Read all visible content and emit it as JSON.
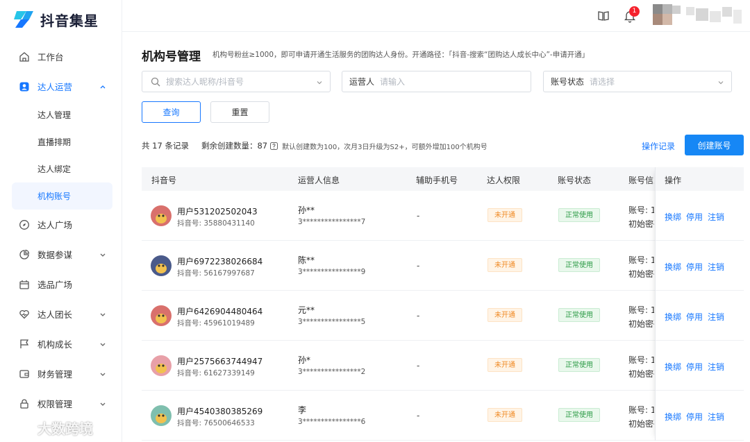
{
  "app": {
    "name": "抖音集星"
  },
  "sidebar": {
    "items": [
      {
        "label": "工作台",
        "icon": "home-icon"
      },
      {
        "label": "达人运营",
        "icon": "user-icon",
        "expanded": true
      },
      {
        "label": "达人广场",
        "icon": "compass-icon"
      },
      {
        "label": "数据参谋",
        "icon": "pie-chart-icon"
      },
      {
        "label": "选品广场",
        "icon": "shop-icon"
      },
      {
        "label": "达人团长",
        "icon": "heart-icon"
      },
      {
        "label": "机构成长",
        "icon": "flag-icon"
      },
      {
        "label": "财务管理",
        "icon": "wallet-icon"
      },
      {
        "label": "权限管理",
        "icon": "lock-icon"
      }
    ],
    "sub_items": [
      {
        "label": "达人管理"
      },
      {
        "label": "直播排期"
      },
      {
        "label": "达人绑定"
      },
      {
        "label": "机构账号",
        "selected": true
      }
    ]
  },
  "topbar": {
    "notification_count": "1"
  },
  "page": {
    "title": "机构号管理",
    "desc": "机构号粉丝≥1000，即可申请开通生活服务的团购达人身份。开通路径：「抖音-搜索“团购达人成长中心”-申请开通」"
  },
  "filters": {
    "search_placeholder": "搜索达人昵称/抖音号",
    "operator_label": "运营人",
    "operator_placeholder": "请输入",
    "status_label": "账号状态",
    "status_placeholder": "请选择"
  },
  "buttons": {
    "query": "查询",
    "reset": "重置",
    "op_log": "操作记录",
    "create": "创建账号"
  },
  "summary": {
    "total": "共 17 条记录",
    "remain": "剩余创建数量：87",
    "note": "默认创建数为100，次月3日升级为S2+，可额外增加100个机构号"
  },
  "table": {
    "headers": [
      "抖音号",
      "运营人信息",
      "辅助手机号",
      "达人权限",
      "账号状态",
      "账号信息",
      "操作"
    ],
    "rows": [
      {
        "name": "用户531202502043",
        "douyin_id": "抖音号: 35880431140",
        "op_name": "孙**",
        "op_phone": "3****************7",
        "phone": "-",
        "permission": "未开通",
        "status": "正常使用",
        "acct": "账号: 1",
        "pwd": "初始密码",
        "avatar_color": "#d9706c"
      },
      {
        "name": "用户6972238026684",
        "douyin_id": "抖音号: 56167997687",
        "op_name": "陈**",
        "op_phone": "3****************9",
        "phone": "-",
        "permission": "未开通",
        "status": "正常使用",
        "acct": "账号: 1",
        "pwd": "初始密码",
        "avatar_color": "#4a5a8a"
      },
      {
        "name": "用户6426904480464",
        "douyin_id": "抖音号: 45961019489",
        "op_name": "元**",
        "op_phone": "3****************5",
        "phone": "-",
        "permission": "未开通",
        "status": "正常使用",
        "acct": "账号: 1",
        "pwd": "初始密码",
        "avatar_color": "#d9706c"
      },
      {
        "name": "用户2575663744947",
        "douyin_id": "抖音号: 61627339149",
        "op_name": "孙*",
        "op_phone": "3****************2",
        "phone": "-",
        "permission": "未开通",
        "status": "正常使用",
        "acct": "账号: 1",
        "pwd": "初始密码",
        "avatar_color": "#e8a0a8"
      },
      {
        "name": "用户4540380385269",
        "douyin_id": "抖音号: 76500646533",
        "op_name": "李",
        "op_phone": "3****************6",
        "phone": "-",
        "permission": "未开通",
        "status": "正常使用",
        "acct": "账号: 1",
        "pwd": "初始密码",
        "avatar_color": "#7fbfae"
      }
    ],
    "actions": [
      "换绑",
      "停用",
      "注销"
    ]
  },
  "watermark": "大数跨境",
  "colors": {
    "accent": "#1677ff",
    "create_button": "#1687f5",
    "tag_off": "#f08a24",
    "tag_on": "#2b9a45"
  }
}
